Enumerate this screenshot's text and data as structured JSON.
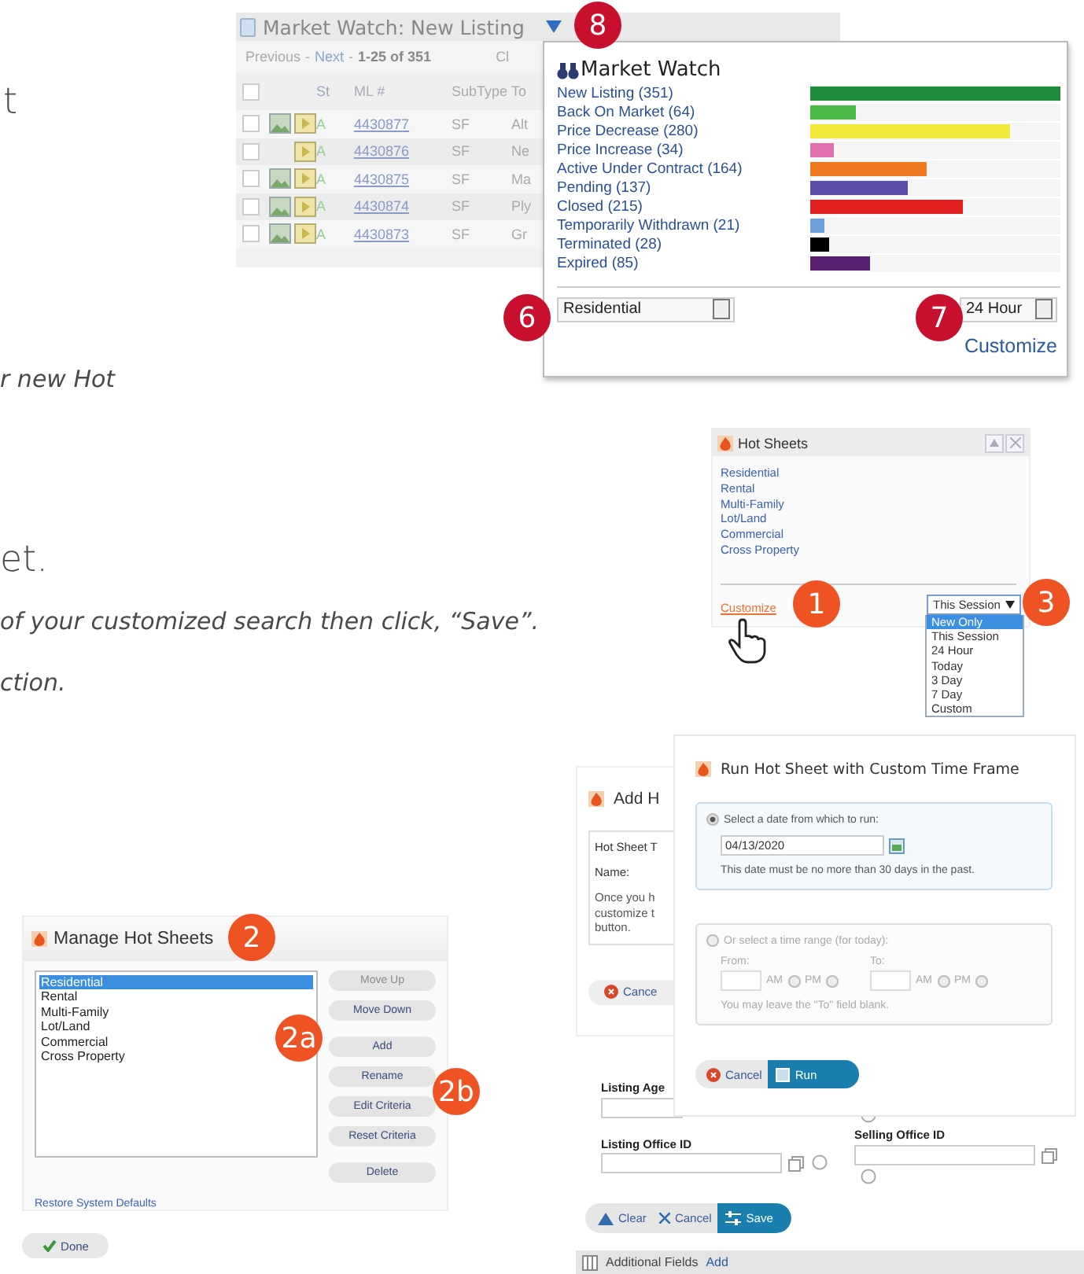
{
  "document_text": [
    {
      "kind": "heading",
      "text": "t"
    },
    {
      "kind": "note",
      "text": "r new Hot"
    },
    {
      "kind": "heading",
      "text": "et."
    },
    {
      "kind": "note",
      "text": "of your customized search then click, “Save”."
    },
    {
      "kind": "note",
      "text": "ction."
    }
  ],
  "market_watch_table": {
    "title": "Market Watch: New Listing",
    "pager": {
      "previous": "Previous",
      "separator": "-",
      "next": "Next",
      "range": "1-25 of 351"
    },
    "column_cut": "Cl",
    "header_checked": false,
    "columns": [
      "St",
      "ML #",
      "SubType",
      "To"
    ],
    "rows": [
      {
        "checked": false,
        "photo": true,
        "status": "A",
        "ml": "4430877",
        "subtype": "SF",
        "column_4": "Alt"
      },
      {
        "checked": false,
        "photo": false,
        "status": "A",
        "ml": "4430876",
        "subtype": "SF",
        "column_4": "Ne"
      },
      {
        "checked": false,
        "photo": true,
        "status": "A",
        "ml": "4430875",
        "subtype": "SF",
        "column_4": "Ma"
      },
      {
        "checked": false,
        "photo": true,
        "status": "A",
        "ml": "4430874",
        "subtype": "SF",
        "column_4": "Ply"
      },
      {
        "checked": false,
        "photo": true,
        "status": "A",
        "ml": "4430873",
        "subtype": "SF",
        "column_4": "Gr"
      }
    ]
  },
  "market_watch_popup": {
    "title": "Market Watch",
    "items": [
      {
        "label": "New Listing (351)",
        "color": "#1e8c3a",
        "level": 1
      },
      {
        "label": "Back On Market (64)",
        "color": "#4cba48",
        "level": 0.182
      },
      {
        "label": "Price Decrease (280)",
        "color": "#f2ea3a",
        "level": 0.798
      },
      {
        "label": "Price Increase (34)",
        "color": "#e070b0",
        "level": 0.097
      },
      {
        "label": "Active Under Contract (164)",
        "color": "#f07a22",
        "level": 0.467
      },
      {
        "label": "Pending (137)",
        "color": "#5a4ea8",
        "level": 0.39
      },
      {
        "label": "Closed (215)",
        "color": "#e02020",
        "level": 0.613
      },
      {
        "label": "Temporarily Withdrawn (21)",
        "color": "#6f9fd8",
        "level": 0.06
      },
      {
        "label": "Terminated (28)",
        "color": "#000000",
        "level": 0.08
      },
      {
        "label": "Expired (85)",
        "color": "#5a2070",
        "level": 0.242
      }
    ],
    "property_select": "Residential",
    "time_select": "24 Hour",
    "customize": "Customize"
  },
  "hot_sheets": {
    "title": "Hot Sheets",
    "items": [
      "Residential",
      "Rental",
      "Multi-Family",
      "Lot/Land",
      "Commercial",
      "Cross Property"
    ],
    "customize": "Customize",
    "time_select": "This Session",
    "options": [
      {
        "label": "New Only",
        "selected": true
      },
      {
        "label": "This Session",
        "selected": false
      },
      {
        "label": "24 Hour",
        "selected": false
      },
      {
        "label": "Today",
        "selected": false
      },
      {
        "label": "3 Day",
        "selected": false
      },
      {
        "label": "7 Day",
        "selected": false
      },
      {
        "label": "Custom",
        "selected": false
      }
    ]
  },
  "manage_hot_sheets": {
    "title": "Manage Hot Sheets",
    "items": [
      {
        "label": "Residential",
        "selected": true
      },
      {
        "label": "Rental",
        "selected": false
      },
      {
        "label": "Multi-Family",
        "selected": false
      },
      {
        "label": "Lot/Land",
        "selected": false
      },
      {
        "label": "Commercial",
        "selected": false
      },
      {
        "label": "Cross Property",
        "selected": false
      }
    ],
    "buttons": [
      {
        "label": "Move Up",
        "disabled": true
      },
      {
        "label": "Move Down",
        "disabled": false
      },
      {
        "label": "Add",
        "disabled": false
      },
      {
        "label": "Rename",
        "disabled": false
      },
      {
        "label": "Edit Criteria",
        "disabled": false
      },
      {
        "label": "Reset Criteria",
        "disabled": false
      },
      {
        "label": "Delete",
        "disabled": false
      }
    ],
    "restore": "Restore System Defaults",
    "done": "Done"
  },
  "add_hot_sheet": {
    "title": "Add H",
    "type_label": "Hot Sheet T",
    "name_label": "Name:",
    "note": [
      "Once you h",
      "customize t",
      "button."
    ],
    "cancel": "Cance"
  },
  "run_hot_sheet": {
    "title": "Run Hot Sheet with Custom Time Frame",
    "date_option": {
      "label": "Select a date from which to run:",
      "selected": true,
      "date": "04/13/2020",
      "note": "This date must be no more than 30 days in the past."
    },
    "range_option": {
      "label": "Or select a time range (for today):",
      "selected": false,
      "from": "From:",
      "from_meridiem": [
        {
          "label": "AM",
          "selected": false
        },
        {
          "label": "PM",
          "selected": false
        }
      ],
      "to": "To:",
      "to_meridiem": [
        {
          "label": "AM",
          "selected": false
        },
        {
          "label": "PM",
          "selected": false
        }
      ],
      "note": "You may leave the \"To\" field blank."
    },
    "cancel": "Cancel",
    "run": "Run"
  },
  "criteria_form": {
    "fields": [
      "Listing Age",
      "Listing Office ID",
      "Selling Office ID"
    ],
    "buttons": [
      "Clear",
      "Cancel",
      "Save"
    ],
    "additional_fields": "Additional Fields",
    "add": "Add"
  },
  "callouts": [
    {
      "label": "8",
      "color": "#c8102e"
    },
    {
      "label": "6",
      "color": "#c8102e"
    },
    {
      "label": "7",
      "color": "#c8102e"
    },
    {
      "label": "1",
      "color": "#f05323"
    },
    {
      "label": "3",
      "color": "#f05323"
    },
    {
      "label": "2",
      "color": "#f05323"
    },
    {
      "label": "2a",
      "color": "#f05323"
    },
    {
      "label": "2b",
      "color": "#f05323"
    }
  ]
}
